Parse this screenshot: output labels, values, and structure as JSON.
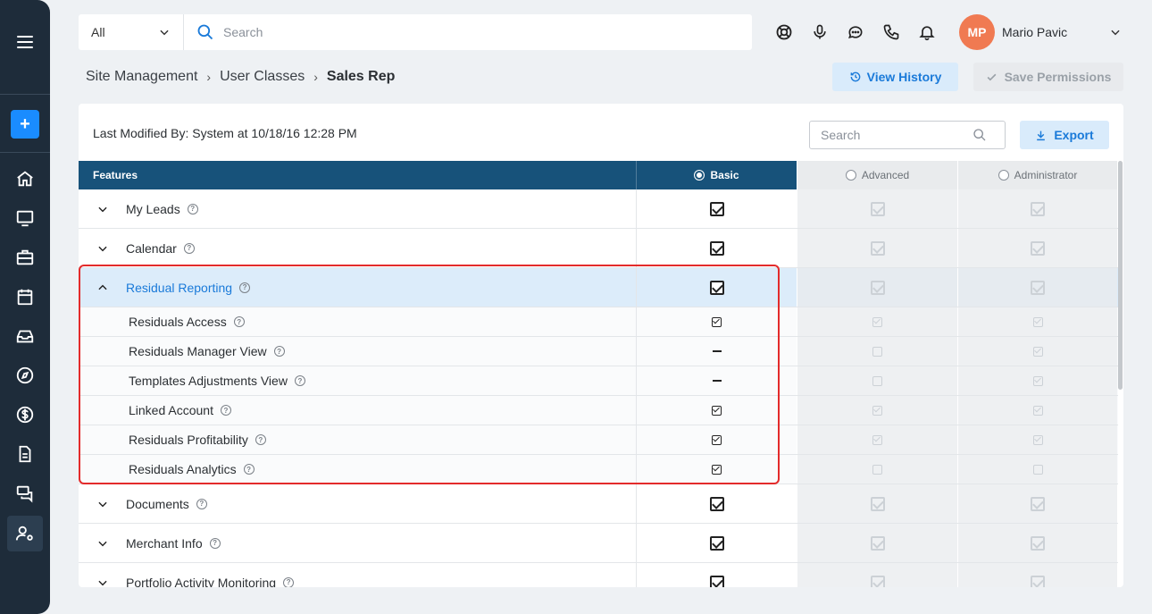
{
  "topbar": {
    "filter_value": "All",
    "search_placeholder": "Search",
    "user_initials": "MP",
    "user_name": "Mario Pavic",
    "icons": [
      "support-icon",
      "microphone-icon",
      "chat-icon",
      "phone-icon",
      "bell-icon"
    ]
  },
  "sidebar": {
    "icons": [
      "home-icon",
      "monitor-icon",
      "briefcase-icon",
      "calendar-icon",
      "inbox-icon",
      "compass-icon",
      "dollar-icon",
      "document-icon",
      "messages-icon",
      "user-settings-icon"
    ]
  },
  "breadcrumb": {
    "items": [
      "Site Management",
      "User Classes"
    ],
    "current": "Sales Rep"
  },
  "actions": {
    "view_history": "View History",
    "save_permissions": "Save Permissions"
  },
  "card": {
    "modified": "Last Modified By: System at 10/18/16 12:28 PM",
    "search_placeholder": "Search",
    "export": "Export"
  },
  "table": {
    "headers": {
      "features": "Features",
      "basic": "Basic",
      "advanced": "Advanced",
      "administrator": "Administrator"
    },
    "selected_class": "Basic",
    "rows": [
      {
        "label": "My Leads",
        "type": "main",
        "expanded": false,
        "basic": "checked",
        "advanced": "checked",
        "administrator": "checked"
      },
      {
        "label": "Calendar",
        "type": "main",
        "expanded": false,
        "basic": "checked",
        "advanced": "checked",
        "administrator": "checked"
      },
      {
        "label": "Residual Reporting",
        "type": "main",
        "expanded": true,
        "basic": "checked",
        "advanced": "checked",
        "administrator": "checked"
      },
      {
        "label": "Residuals Access",
        "type": "sub",
        "basic": "checked",
        "advanced": "checked",
        "administrator": "checked"
      },
      {
        "label": "Residuals Manager View",
        "type": "sub",
        "basic": "dash",
        "advanced": "empty",
        "administrator": "checked"
      },
      {
        "label": "Templates Adjustments View",
        "type": "sub",
        "basic": "dash",
        "advanced": "empty",
        "administrator": "checked"
      },
      {
        "label": "Linked Account",
        "type": "sub",
        "basic": "checked",
        "advanced": "checked",
        "administrator": "checked"
      },
      {
        "label": "Residuals Profitability",
        "type": "sub",
        "basic": "checked",
        "advanced": "checked",
        "administrator": "checked"
      },
      {
        "label": "Residuals Analytics",
        "type": "sub",
        "basic": "checked",
        "advanced": "empty",
        "administrator": "empty"
      },
      {
        "label": "Documents",
        "type": "main",
        "expanded": false,
        "basic": "checked",
        "advanced": "checked",
        "administrator": "checked"
      },
      {
        "label": "Merchant Info",
        "type": "main",
        "expanded": false,
        "basic": "checked",
        "advanced": "checked",
        "administrator": "checked"
      },
      {
        "label": "Portfolio Activity Monitoring",
        "type": "main",
        "expanded": false,
        "basic": "checked",
        "advanced": "checked",
        "administrator": "checked"
      }
    ]
  }
}
